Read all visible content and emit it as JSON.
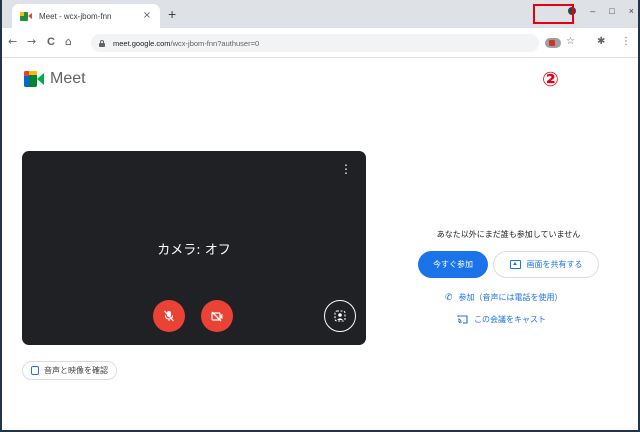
{
  "browser": {
    "tab_title": "Meet - wcx-jbom-fnn",
    "tab_close": "×",
    "new_tab": "+",
    "url_host": "meet.google.com",
    "url_path": "/wcx-jbom-fnn?authuser=0",
    "nav": {
      "back": "←",
      "forward": "→",
      "reload": "C",
      "home": "⌂"
    },
    "window": {
      "minimize": "–",
      "maximize": "□",
      "close": "×"
    },
    "toolbar_icons": {
      "bookmark": "☆",
      "extensions": "✱",
      "menu": "⋮"
    }
  },
  "annotation": {
    "label": "②",
    "color": "#e60012"
  },
  "app": {
    "name": "Meet"
  },
  "preview": {
    "status": "カメラ: オフ",
    "more": "⋮"
  },
  "check": {
    "label": "音声と映像を確認"
  },
  "join": {
    "status": "あなた以外にまだ誰も参加していません",
    "join_now": "今すぐ参加",
    "present": "画面を共有する",
    "join_phone": "参加（音声には電話を使用）",
    "cast": "この会議をキャスト"
  },
  "colors": {
    "accent": "#1a73e8",
    "danger": "#ea4335",
    "preview_bg": "#202124"
  }
}
